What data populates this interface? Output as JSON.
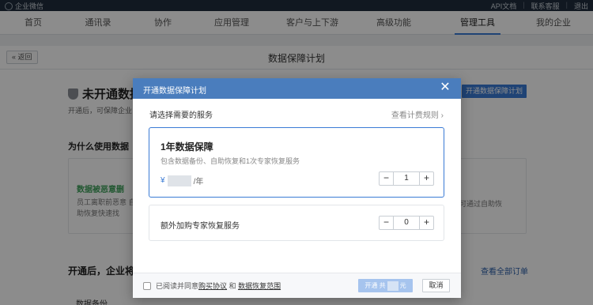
{
  "topbar": {
    "brand": "企业微信",
    "links": [
      "API文档",
      "联系客服",
      "退出"
    ]
  },
  "nav": {
    "items": [
      "首页",
      "通讯录",
      "协作",
      "应用管理",
      "客户与上下游",
      "高级功能",
      "管理工具",
      "我的企业"
    ],
    "active": "管理工具"
  },
  "page": {
    "back_label": "返回",
    "title": "数据保障计划"
  },
  "background": {
    "status_title": "未开通数据",
    "status_sub": "开通后，可保障企业",
    "cta": "开通数据保障计划",
    "why_title": "为什么使用数据",
    "card_title": "数据被恶意删",
    "card_text": "员工离职前恶意 自助恢复快速找",
    "card_right": "，可通过自助恢",
    "after_title": "开通后，企业将",
    "view_orders": "查看全部订单",
    "items": "数据备份"
  },
  "modal": {
    "title": "开通数据保障计划",
    "section_label": "请选择需要的服务",
    "rules_link": "查看计费规则 ›",
    "plan": {
      "title": "1年数据保障",
      "desc": "包含数据备份、自助恢复和1次专家恢复服务",
      "currency": "¥",
      "unit": "/年",
      "quantity": "1"
    },
    "addon": {
      "label": "额外加购专家恢复服务",
      "quantity": "0"
    },
    "footer": {
      "agree_prefix": "已阅读并同意",
      "purchase_agreement": "购买协议",
      "and": "和",
      "recovery_scope": "数据恢复范围",
      "pay_prefix": "开通 共",
      "pay_suffix": "元",
      "cancel": "取消"
    }
  },
  "colors": {
    "accent": "#3a7bd5",
    "modal_header": "#4a7dbd",
    "pay_disabled": "#a6c4ee"
  }
}
